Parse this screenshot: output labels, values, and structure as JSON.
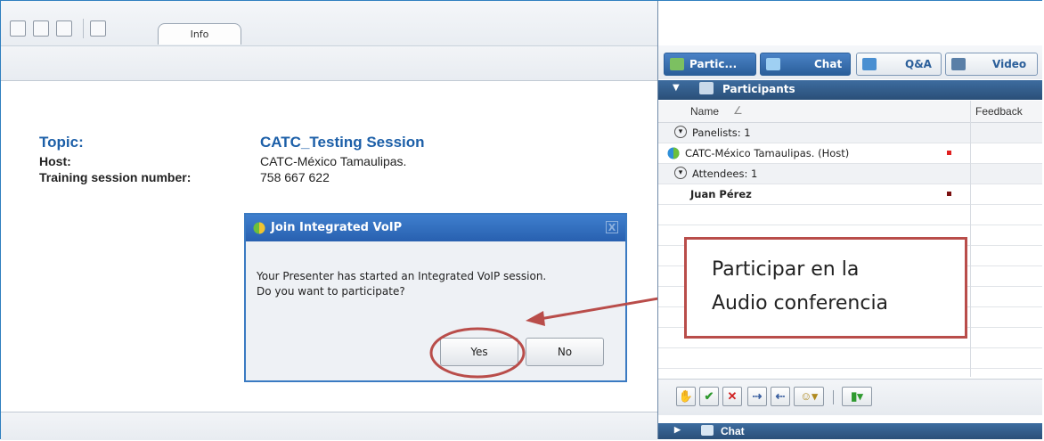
{
  "tabs": {
    "info": "Info"
  },
  "session_info": {
    "topic_label": "Topic:",
    "topic_value": "CATC_Testing Session",
    "host_label": "Host:",
    "host_value": "CATC-México Tamaulipas.",
    "number_label": "Training session number:",
    "number_value": "758 667 622"
  },
  "dialog": {
    "title": "Join Integrated VoIP",
    "close": "X",
    "message_line1": "Your Presenter has started an Integrated VoIP session.",
    "message_line2": "Do you want to participate?",
    "yes": "Yes",
    "no": "No"
  },
  "right_tabs": [
    {
      "label": "Partic..."
    },
    {
      "label": "Chat"
    },
    {
      "label": "Q&A"
    },
    {
      "label": "Video"
    }
  ],
  "participants": {
    "header": "Participants",
    "col_name": "Name",
    "sort_glyph": "∠",
    "col_feedback": "Feedback",
    "panelists_label": "Panelists: 1",
    "panelist": "CATC-México Tamaulipas. (Host)",
    "attendees_label": "Attendees: 1",
    "attendee": "Juan Pérez"
  },
  "chat_section": {
    "label": "Chat"
  },
  "callout": {
    "line1": "Participar en la",
    "line2": "Audio conferencia"
  },
  "colors": {
    "accent_blue": "#1c5fa8",
    "callout_red": "#b94d4a",
    "panel_header": "#2a4f78"
  }
}
